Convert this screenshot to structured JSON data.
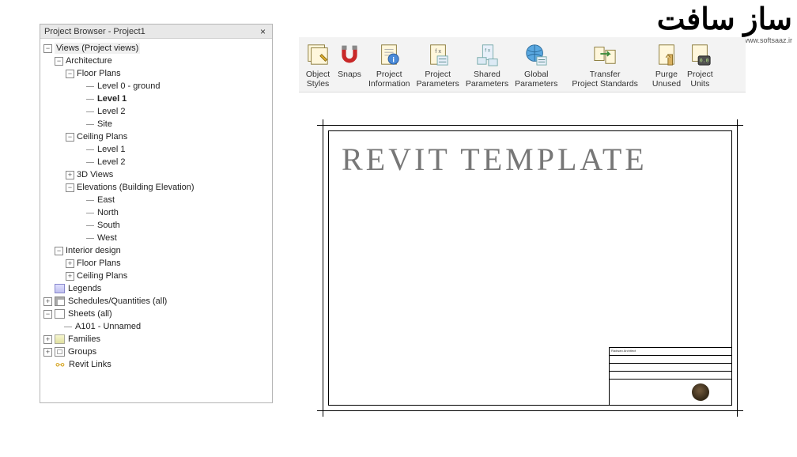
{
  "logo": {
    "main": "ساز سافت",
    "sub": "www.softsaaz.ir"
  },
  "browser": {
    "title": "Project Browser - Project1",
    "close": "×"
  },
  "tree": {
    "views_root": "Views (Project views)",
    "architecture": "Architecture",
    "floor_plans": "Floor Plans",
    "level0": "Level 0 - ground",
    "level1": "Level 1",
    "level2_fp": "Level 2",
    "site": "Site",
    "ceiling_plans": "Ceiling Plans",
    "cp_level1": "Level 1",
    "cp_level2": "Level 2",
    "views3d": "3D Views",
    "elevations": "Elevations (Building Elevation)",
    "east": "East",
    "north": "North",
    "south": "South",
    "west": "West",
    "interior": "Interior design",
    "int_floor": "Floor Plans",
    "int_ceiling": "Ceiling Plans",
    "legends": "Legends",
    "schedules": "Schedules/Quantities (all)",
    "sheets": "Sheets (all)",
    "sheet_a101": "A101 - Unnamed",
    "families": "Families",
    "groups": "Groups",
    "revit_links": "Revit Links"
  },
  "ribbon": {
    "object_styles": {
      "l1": "Object",
      "l2": "Styles"
    },
    "snaps": {
      "l1": "Snaps",
      "l2": ""
    },
    "project_info": {
      "l1": "Project",
      "l2": "Information"
    },
    "project_params": {
      "l1": "Project",
      "l2": "Parameters"
    },
    "shared_params": {
      "l1": "Shared",
      "l2": "Parameters"
    },
    "global_params": {
      "l1": "Global",
      "l2": "Parameters"
    },
    "transfer": {
      "l1": "Transfer",
      "l2": "Project Standards"
    },
    "purge": {
      "l1": "Purge",
      "l2": "Unused"
    },
    "units": {
      "l1": "Project",
      "l2": "Units"
    }
  },
  "sheet": {
    "template_title": "Revit Template",
    "tb_role": "Radwan Architect"
  }
}
